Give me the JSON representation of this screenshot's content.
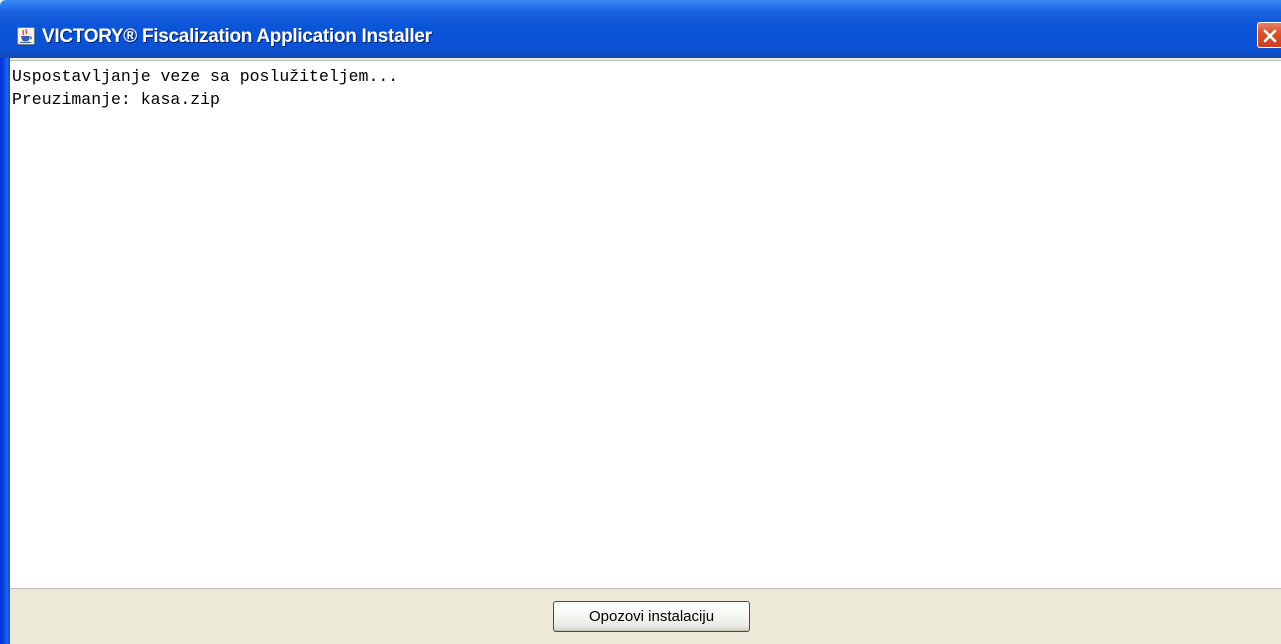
{
  "window": {
    "title": "VICTORY® Fiscalization Application Installer",
    "icon": "java-coffee-cup-icon",
    "close_icon": "close-icon",
    "titlebar_color": "#0A55D8",
    "close_color": "#D9532F"
  },
  "log": {
    "lines": [
      "Uspostavljanje veze sa poslužiteljem...",
      "Preuzimanje: kasa.zip"
    ]
  },
  "footer": {
    "cancel_label": "Opozovi instalaciju"
  }
}
